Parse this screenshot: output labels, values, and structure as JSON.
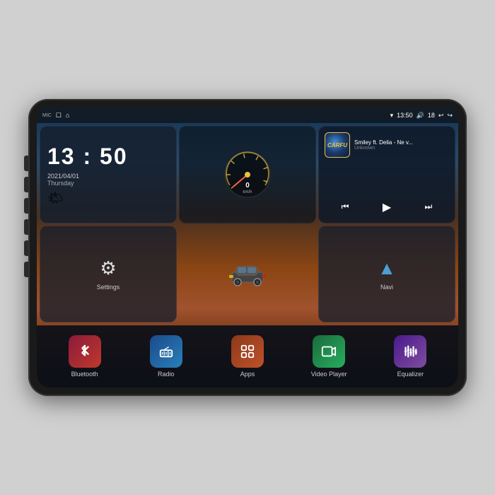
{
  "device": {
    "background_color": "#d0d0d0"
  },
  "status_bar": {
    "mic_label": "MIC",
    "time": "13:50",
    "battery": "18",
    "wifi_icon": "wifi",
    "volume_icon": "volume",
    "back_icon": "back",
    "home_icon": "home",
    "battery_icon": "battery"
  },
  "clock_widget": {
    "time": "13 : 50",
    "date": "2021/04/01",
    "day": "Thursday",
    "weather_icon": "🌤"
  },
  "music_widget": {
    "logo": "CARFU",
    "title": "Smiley ft. Delia - Ne v...",
    "artist": "Unknown",
    "prev_icon": "⏮",
    "play_icon": "▶",
    "next_icon": "⏭"
  },
  "settings_widget": {
    "label": "Settings",
    "icon": "⚙"
  },
  "navi_widget": {
    "label": "Navi",
    "icon": "navigation"
  },
  "bottom_apps": [
    {
      "label": "Bluetooth",
      "icon": "bluetooth",
      "theme": "bluetooth"
    },
    {
      "label": "Radio",
      "icon": "radio",
      "theme": "radio"
    },
    {
      "label": "Apps",
      "icon": "apps",
      "theme": "apps"
    },
    {
      "label": "Video Player",
      "icon": "video",
      "theme": "video"
    },
    {
      "label": "Equalizer",
      "icon": "equalizer",
      "theme": "eq"
    }
  ],
  "speedometer": {
    "speed": "0",
    "unit": "km/h"
  }
}
